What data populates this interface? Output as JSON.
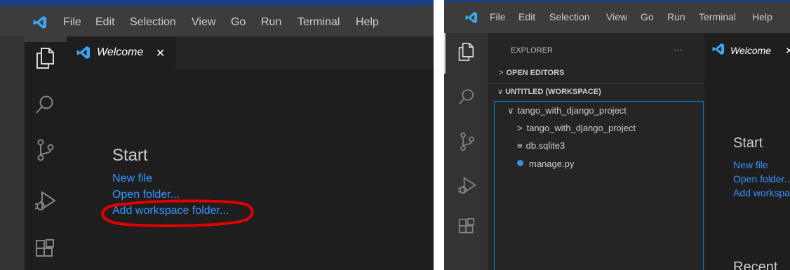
{
  "menu": [
    "File",
    "Edit",
    "Selection",
    "View",
    "Go",
    "Run",
    "Terminal",
    "Help"
  ],
  "icons": {
    "explorer": "files-icon",
    "search": "search-icon",
    "scm": "source-control-icon",
    "run": "run-debug-icon",
    "extensions": "extensions-icon",
    "logo": "vscode-logo-icon"
  },
  "left": {
    "tab": {
      "label": "Welcome",
      "close": "✕"
    },
    "start": {
      "title": "Start",
      "new_file": "New file",
      "open_folder": "Open folder...",
      "add_workspace": "Add workspace folder..."
    }
  },
  "right": {
    "explorer": {
      "title": "EXPLORER",
      "more": "···",
      "open_editors": "OPEN EDITORS",
      "workspace": "UNTITLED (WORKSPACE)",
      "tree": [
        {
          "label": "tango_with_django_project",
          "type": "folder-open"
        },
        {
          "label": "tango_with_django_project",
          "type": "folder-closed"
        },
        {
          "label": "db.sqlite3",
          "type": "file-text"
        },
        {
          "label": "manage.py",
          "type": "file-python"
        }
      ]
    },
    "tab": {
      "label": "Welcome",
      "close": "✕"
    },
    "start": {
      "title": "Start",
      "new_file": "New file",
      "open_folder": "Open folder...",
      "add_workspace": "Add workspace folder..."
    },
    "recent_title": "Recent"
  },
  "colors": {
    "accent": "#3794ff",
    "annotation": "#e00000",
    "titlebar": "#3c3c3c",
    "editor": "#1e1e1e"
  }
}
